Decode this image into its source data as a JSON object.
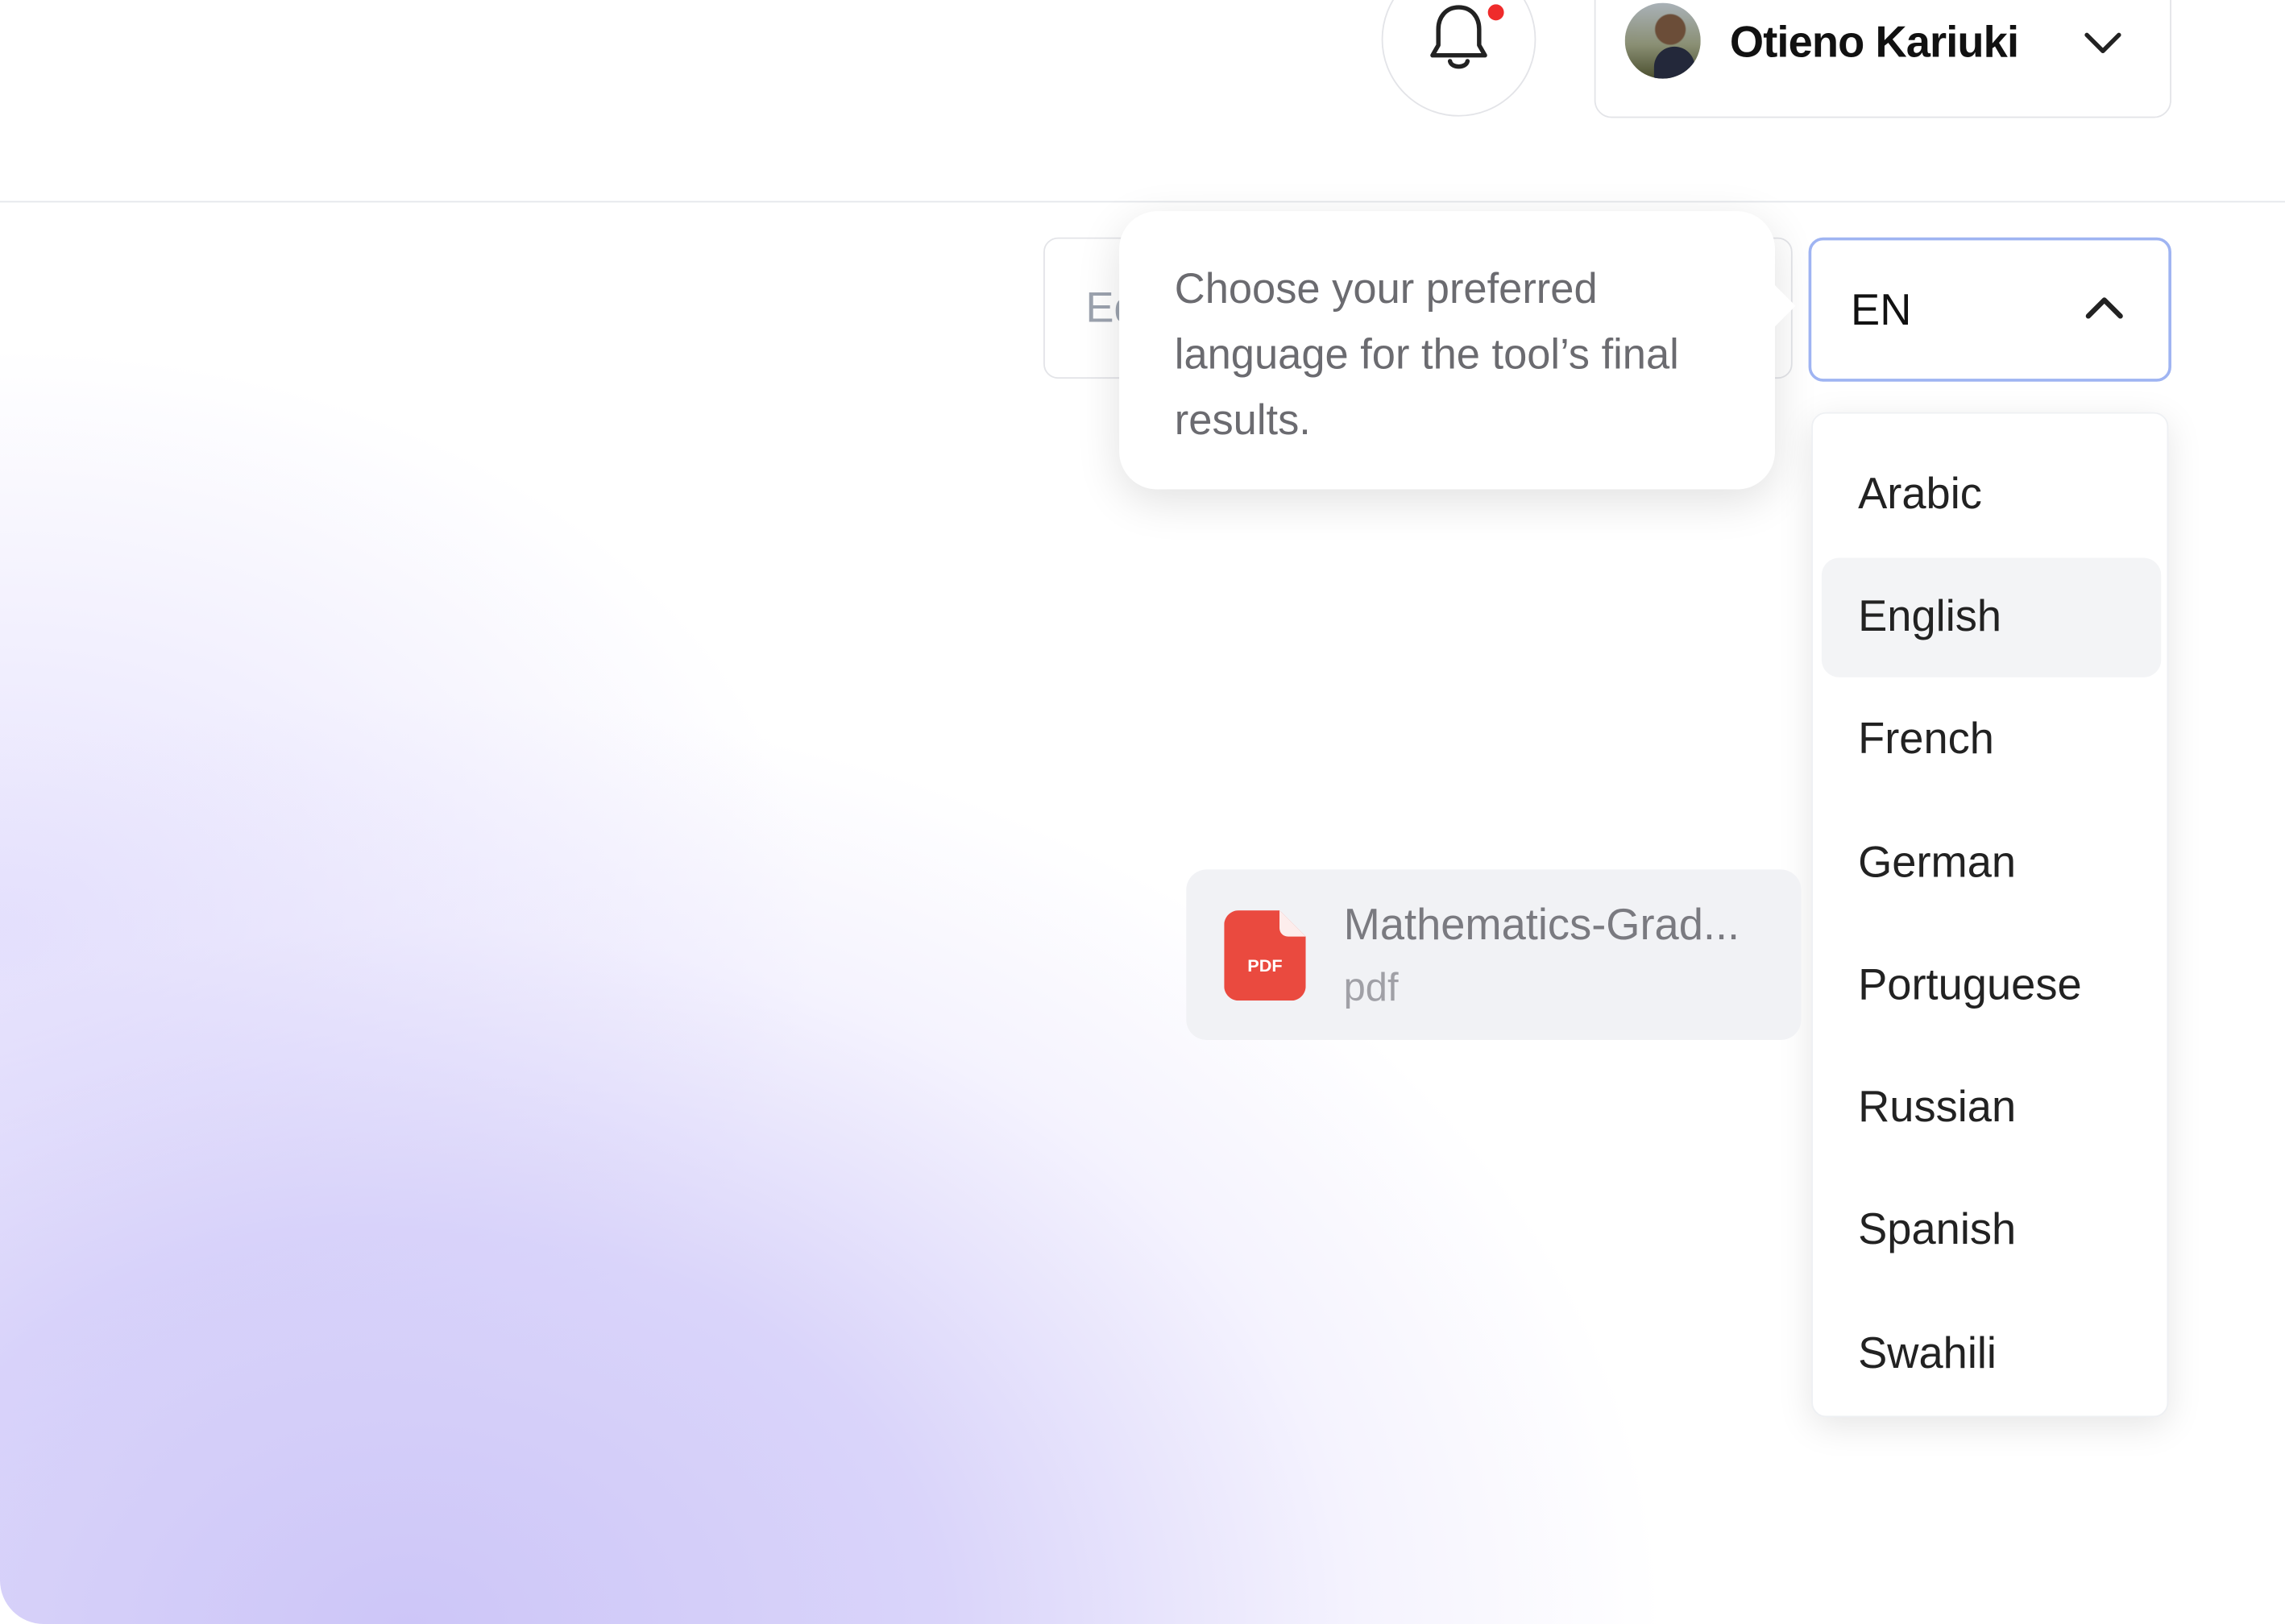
{
  "header": {
    "notifications_label": "Notifications",
    "user_name": "Otieno Kariuki"
  },
  "hidden_input": {
    "visible_text": "Ed"
  },
  "tooltip": {
    "text": "Choose your preferred language for the tool’s final results."
  },
  "language": {
    "selected": "EN",
    "options": [
      "Arabic",
      "English",
      "French",
      "German",
      "Portuguese",
      "Russian",
      "Spanish",
      "Swahili"
    ],
    "highlighted": "English"
  },
  "file": {
    "name": "Mathematics-Grad...",
    "extension": "pdf",
    "icon_label": "PDF"
  },
  "colors": {
    "accent_border": "#9fb4f2",
    "notification_dot": "#ef2b2b",
    "pdf_red": "#ea4a3f",
    "gradient_purple": "#cdc6f8"
  }
}
